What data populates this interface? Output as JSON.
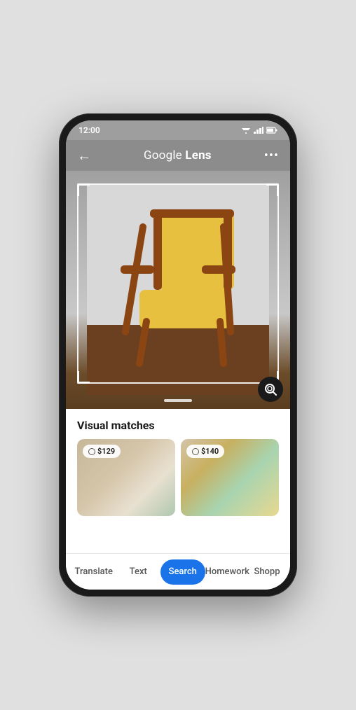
{
  "status_bar": {
    "time": "12:00",
    "signal_icon": "signal",
    "wifi_icon": "wifi",
    "battery_icon": "battery"
  },
  "top_bar": {
    "back_label": "←",
    "title_prefix": "Google ",
    "title_suffix": "Lens",
    "more_label": "•••"
  },
  "image": {
    "alt": "Yellow chair with wooden frame"
  },
  "lens_button": {
    "icon": "lens-icon"
  },
  "content": {
    "visual_matches_label": "Visual matches",
    "matches": [
      {
        "price": "$129",
        "alt": "Chair match 1"
      },
      {
        "price": "$140",
        "alt": "Chair match 2"
      }
    ]
  },
  "tab_bar": {
    "tabs": [
      {
        "label": "Translate",
        "active": false
      },
      {
        "label": "Text",
        "active": false
      },
      {
        "label": "Search",
        "active": true
      },
      {
        "label": "Homework",
        "active": false
      },
      {
        "label": "Shopp",
        "active": false
      }
    ]
  }
}
